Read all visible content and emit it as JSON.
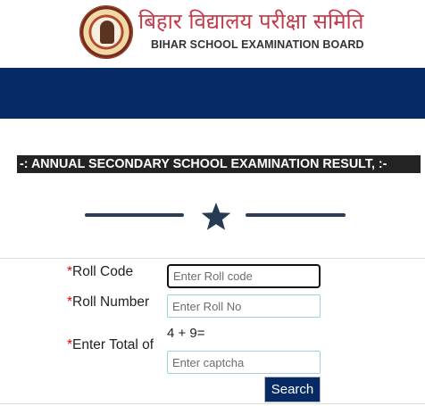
{
  "header": {
    "title_hindi": "बिहार विद्यालय परीक्षा समिति",
    "title_english": "BIHAR SCHOOL EXAMINATION BOARD",
    "logo_icon": "bseb-seal-logo"
  },
  "colors": {
    "brand_navy": "#062a66",
    "title_red": "#c33b4a",
    "banner_dark": "#232323",
    "required_red": "#e10000"
  },
  "banner": {
    "text": "-: ANNUAL SECONDARY SCHOOL EXAMINATION RESULT, :-"
  },
  "divider": {
    "icon": "star-icon"
  },
  "form": {
    "required_mark": "*",
    "roll_code": {
      "label": "Roll Code",
      "placeholder": "Enter Roll code",
      "value": ""
    },
    "roll_number": {
      "label": "Roll Number",
      "placeholder": "Enter Roll No",
      "value": ""
    },
    "captcha": {
      "label": "Enter Total of",
      "question": "4 + 9=",
      "placeholder": "Enter captcha",
      "value": ""
    },
    "search_label": "Search"
  }
}
